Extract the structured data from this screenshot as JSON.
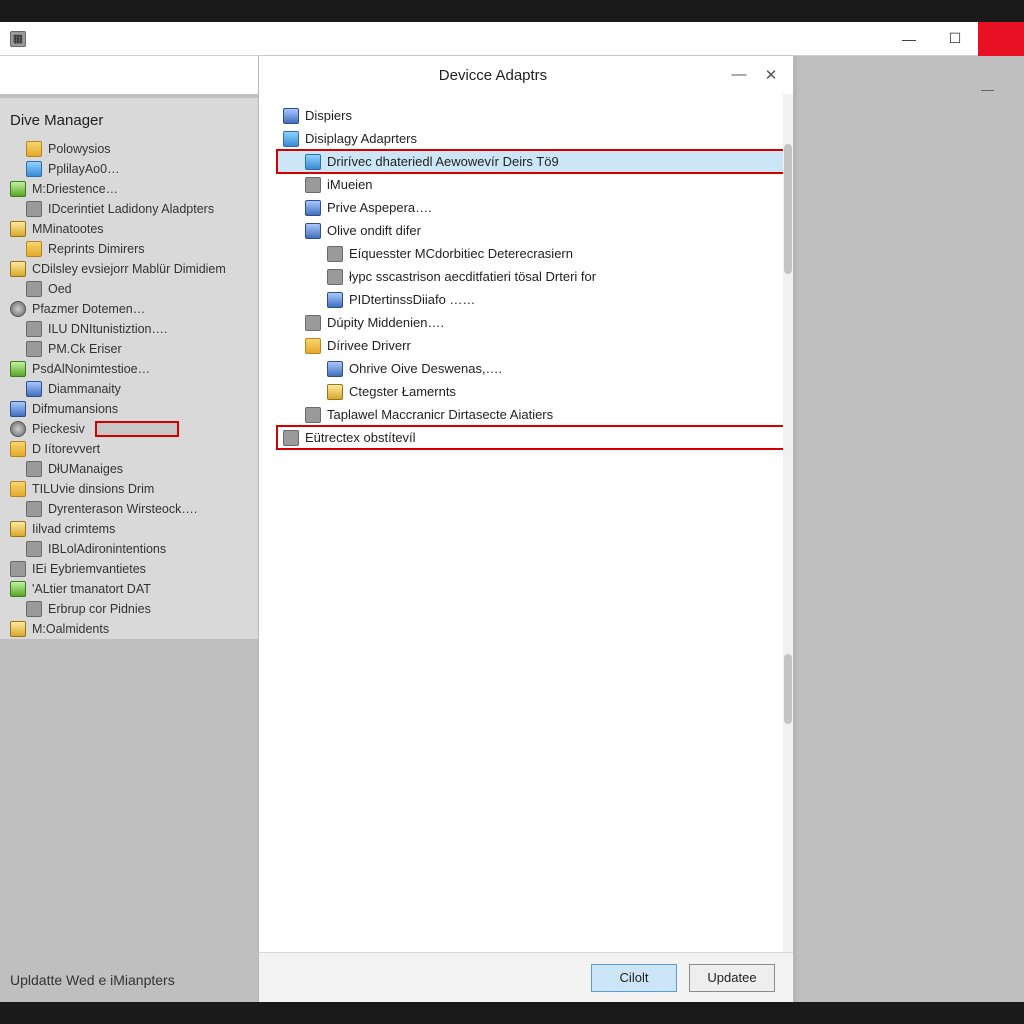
{
  "back_window": {
    "wc": {
      "min": "—",
      "max": "☐",
      "close": ""
    },
    "menu_dash": "—"
  },
  "sidebar": {
    "title": "Dive Manager",
    "items": [
      {
        "label": "Polowysios",
        "lvl": 1,
        "icon": "folder"
      },
      {
        "label": "PplilayAo0…",
        "lvl": 1,
        "icon": "monitor"
      },
      {
        "label": "M:Driestence…",
        "lvl": 0,
        "icon": "card"
      },
      {
        "label": "IDcerintiet Ladidony Aladpters",
        "lvl": 1,
        "icon": "grey"
      },
      {
        "label": "MMinatootes",
        "lvl": 0,
        "icon": "gold"
      },
      {
        "label": "Reprints Dimirers",
        "lvl": 1,
        "icon": "folder"
      },
      {
        "label": "CDilsley evsiejorr Mablür Dimidiem",
        "lvl": 0,
        "icon": "gold"
      },
      {
        "label": "Oed",
        "lvl": 1,
        "icon": "grey"
      },
      {
        "label": "Pfazmer Dotemen…",
        "lvl": 0,
        "icon": "gear"
      },
      {
        "label": "ILU DNItunistiztion….",
        "lvl": 1,
        "icon": "grey"
      },
      {
        "label": "PM.Ck Eriser",
        "lvl": 1,
        "icon": "grey"
      },
      {
        "label": "PsdAlNonimtestioe…",
        "lvl": 0,
        "icon": "card"
      },
      {
        "label": "Diammanaity",
        "lvl": 1,
        "icon": "blue"
      },
      {
        "label": "Difmumansions",
        "lvl": 0,
        "icon": "blue",
        "boxed": false
      },
      {
        "label": "Pieckesiv",
        "lvl": 0,
        "icon": "gear",
        "boxed": true
      },
      {
        "label": "D Iítorevvert",
        "lvl": 0,
        "icon": "folder"
      },
      {
        "label": "DłUManaiges",
        "lvl": 1,
        "icon": ""
      },
      {
        "label": "TILUvie dinsions Drim",
        "lvl": 0,
        "icon": "folder"
      },
      {
        "label": "Dyrenterason Wirsteock….",
        "lvl": 1,
        "icon": "grey"
      },
      {
        "label": "Iilvad crimtems",
        "lvl": 0,
        "icon": "gold"
      },
      {
        "label": "IBLolAdironintentions",
        "lvl": 1,
        "icon": "grey"
      },
      {
        "label": "IEi Eybriemvantietes",
        "lvl": 0,
        "icon": "grey"
      },
      {
        "label": "'ALtier tmanatort DAT",
        "lvl": 0,
        "icon": "card"
      },
      {
        "label": "Erbrup cor Pidnies",
        "lvl": 1,
        "icon": "grey"
      },
      {
        "label": "M:Oalmidents",
        "lvl": 0,
        "icon": "gold"
      }
    ]
  },
  "dialog": {
    "title": "Devicce Adaptrs",
    "wc": {
      "min": "—",
      "close": "✕"
    },
    "items": [
      {
        "label": "Dispiers",
        "lvl": 1,
        "icon": "blue"
      },
      {
        "label": "Disiplagy Adaprters",
        "lvl": 1,
        "icon": "monitor"
      },
      {
        "label": "Drirívec dhateriedl Aewowevír Deirs Tö9",
        "lvl": 2,
        "icon": "monitor",
        "selected": true,
        "boxed": true
      },
      {
        "label": "iMueien",
        "lvl": 2,
        "icon": ""
      },
      {
        "label": "Prive Aspepera….",
        "lvl": 2,
        "icon": "blue"
      },
      {
        "label": "Olive ondift difer",
        "lvl": 2,
        "icon": "blue"
      },
      {
        "label": "Eíquesster MCdorbitiec Deterecrasiern",
        "lvl": 3,
        "icon": "grey"
      },
      {
        "label": "łypc sscastrison aecditfatieri tösal Drteri for",
        "lvl": 3,
        "icon": "grey"
      },
      {
        "label": "PIDtertinssDiiafo ……",
        "lvl": 3,
        "icon": "blue"
      },
      {
        "label": "Dúpity Middenien….",
        "lvl": 2,
        "icon": ""
      },
      {
        "label": "Dírivee Driverr",
        "lvl": 2,
        "icon": "folder"
      },
      {
        "label": "Ohrive Oive Deswenas,….",
        "lvl": 3,
        "icon": "blue"
      },
      {
        "label": "Ctegster Łamernts",
        "lvl": 3,
        "icon": "gold"
      },
      {
        "label": "Taplawel Maccranicr Dirtasecte Aiatiers",
        "lvl": 2,
        "icon": ""
      },
      {
        "label": "Eütrectex obstítevíl",
        "lvl": 1,
        "icon": "grey",
        "boxed": true
      }
    ]
  },
  "footer": {
    "status": "Upldatte Wed e iMianpters",
    "btn_primary": "Cilolt",
    "btn_secondary": "Updatee"
  }
}
